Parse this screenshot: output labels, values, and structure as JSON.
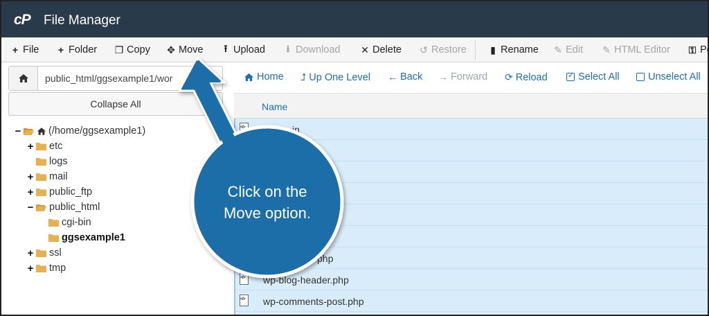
{
  "app": {
    "logo": "cP",
    "title": "File Manager"
  },
  "toolbar": {
    "file": "File",
    "folder": "Folder",
    "copy": "Copy",
    "move": "Move",
    "upload": "Upload",
    "download": "Download",
    "delete": "Delete",
    "restore": "Restore",
    "rename": "Rename",
    "edit": "Edit",
    "html_editor": "HTML Editor",
    "permissions": "Pe"
  },
  "sidebar": {
    "path": "public_html/ggsexample1/wor",
    "collapse_all": "Collapse All",
    "tree": {
      "root": "(/home/ggsexample1)",
      "etc": "etc",
      "logs": "logs",
      "mail": "mail",
      "public_ftp": "public_ftp",
      "public_html": "public_html",
      "cgi_bin": "cgi-bin",
      "ggsexample1": "ggsexample1",
      "ssl": "ssl",
      "tmp": "tmp"
    }
  },
  "nav": {
    "home": "Home",
    "up": "Up One Level",
    "back": "Back",
    "forward": "Forward",
    "reload": "Reload",
    "select_all": "Select All",
    "unselect_all": "Unselect All"
  },
  "table": {
    "name_header": "Name"
  },
  "files": [
    {
      "name": "in"
    },
    {
      "name": ""
    },
    {
      "name": ""
    },
    {
      "name": ""
    },
    {
      "name": ""
    },
    {
      "name": ""
    },
    {
      "name": "php"
    },
    {
      "name": "wp-blog-header.php"
    },
    {
      "name": "wp-comments-post.php"
    }
  ],
  "callout": {
    "line1": "Click on the",
    "line2": "Move option."
  },
  "colors": {
    "titlebar": "#293a4a",
    "accent": "#1b6fb5",
    "selected_row": "#d9ecf9",
    "callout": "#1b6ea8",
    "folder": "#e8b14f"
  }
}
